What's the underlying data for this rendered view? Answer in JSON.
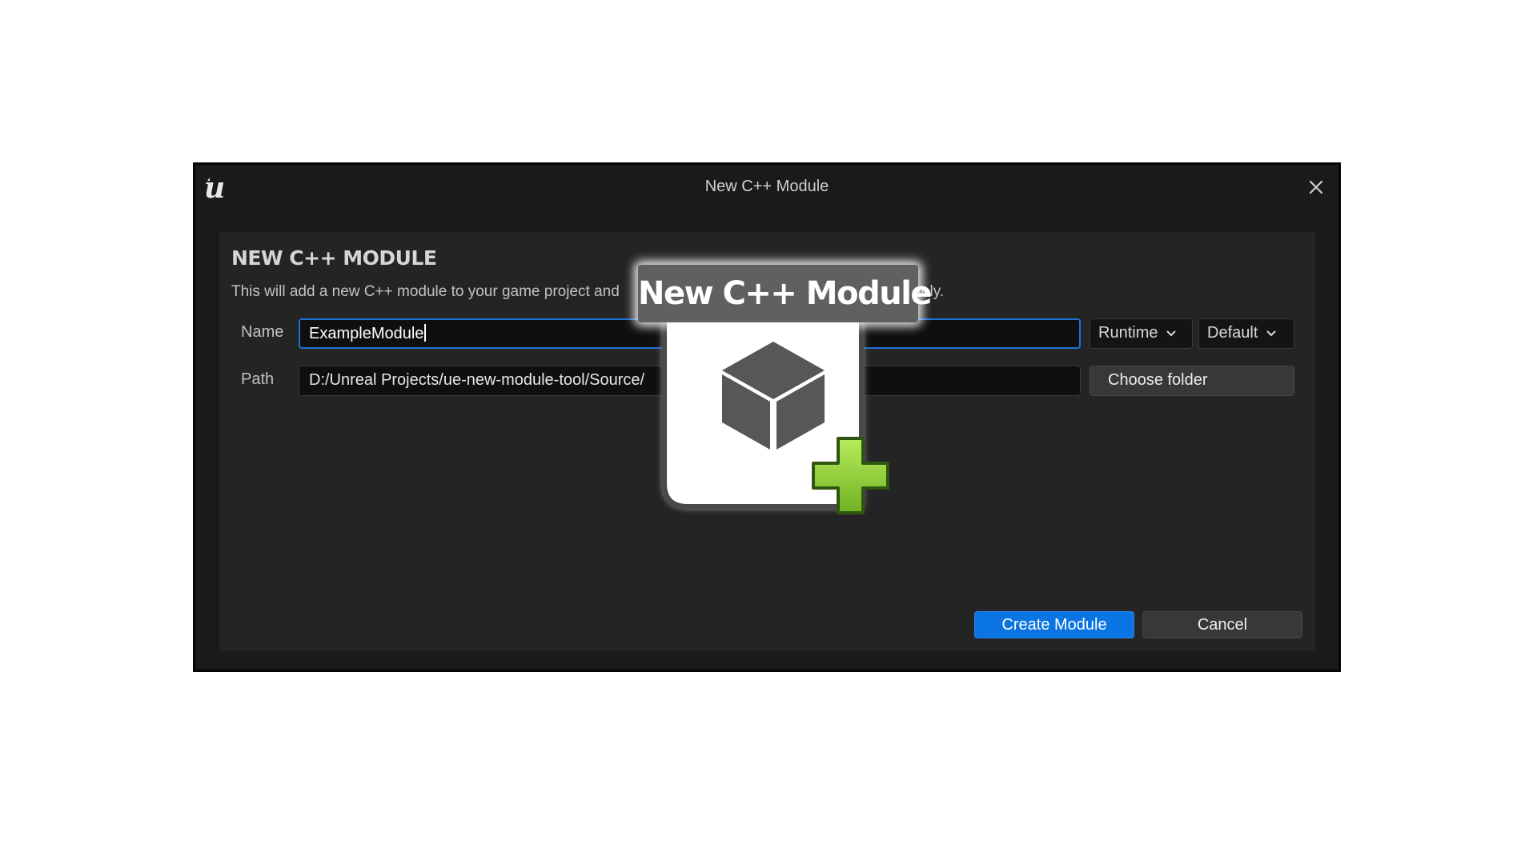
{
  "window": {
    "title": "New C++ Module",
    "logo_icon": "unreal-engine-logo",
    "close_icon": "close-icon"
  },
  "panel": {
    "heading": "NEW C++ MODULE",
    "description": "This will add a new C++ module to your game project and",
    "description_tail": "spectively."
  },
  "form": {
    "name_label": "Name",
    "name_value": "ExampleModule",
    "path_label": "Path",
    "path_value": "D:/Unreal Projects/ue-new-module-tool/Source/",
    "type_value": "Runtime",
    "loading_phase_value": "Default",
    "choose_folder_label": "Choose folder"
  },
  "actions": {
    "create_label": "Create Module",
    "cancel_label": "Cancel"
  },
  "overlay": {
    "title": "New C++ Module",
    "icon": "cube-icon",
    "plus_icon": "plus-icon",
    "plus_color": "#7ec529"
  },
  "colors": {
    "accent": "#0a74e3",
    "focus_border": "#1f6fd6",
    "window_bg": "#1a1a1a",
    "panel_bg": "#242424"
  }
}
